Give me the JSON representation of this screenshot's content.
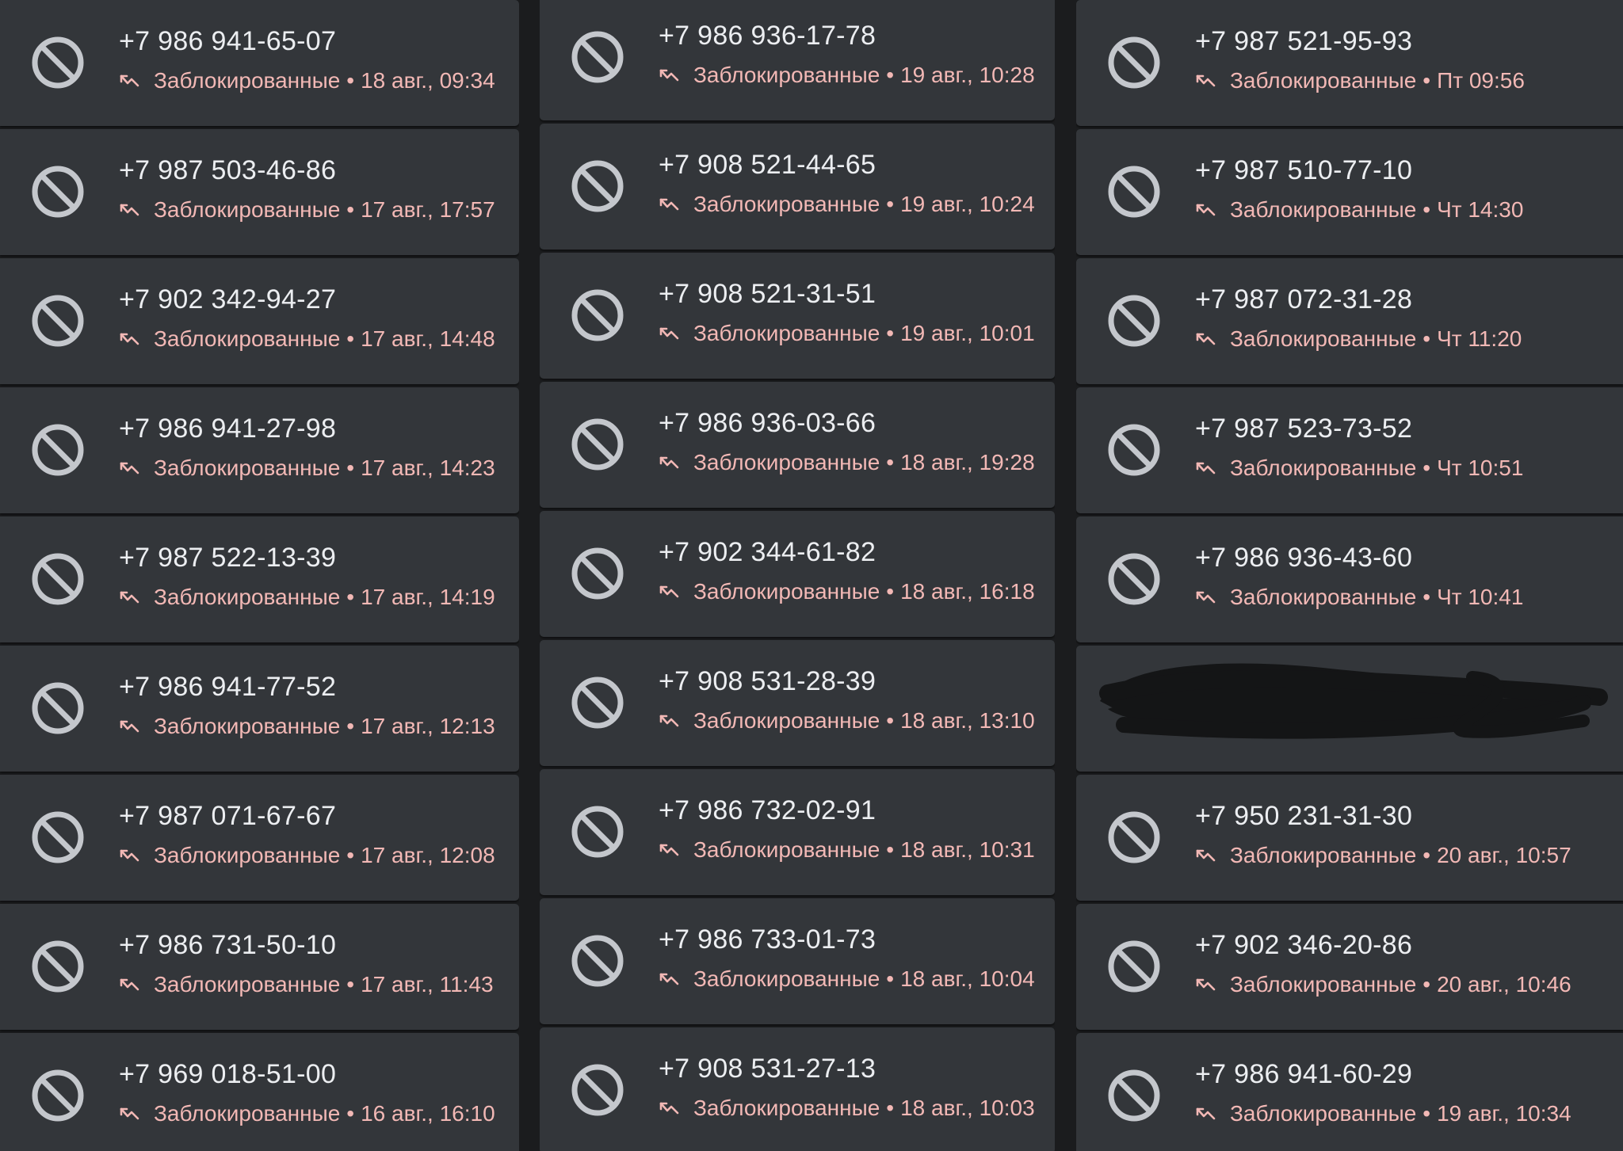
{
  "colors": {
    "card_bg": "#33363a",
    "gap_bg": "#1b1c1e",
    "number_text": "#eceef1",
    "status_text": "#f2b8b5",
    "icon": "#c4c7cc",
    "redaction": "#141516"
  },
  "icons": {
    "entry_icon": "blocked-circle-icon",
    "status_icon": "missed-call-arrow-icon"
  },
  "columns": [
    {
      "entries": [
        {
          "number": "+7 986 941-65-07",
          "label": "Заблокированные",
          "time": "18 авг., 09:34"
        },
        {
          "number": "+7 987 503-46-86",
          "label": "Заблокированные",
          "time": "17 авг., 17:57"
        },
        {
          "number": "+7 902 342-94-27",
          "label": "Заблокированные",
          "time": "17 авг., 14:48"
        },
        {
          "number": "+7 986 941-27-98",
          "label": "Заблокированные",
          "time": "17 авг., 14:23"
        },
        {
          "number": "+7 987 522-13-39",
          "label": "Заблокированные",
          "time": "17 авг., 14:19"
        },
        {
          "number": "+7 986 941-77-52",
          "label": "Заблокированные",
          "time": "17 авг., 12:13"
        },
        {
          "number": "+7 987 071-67-67",
          "label": "Заблокированные",
          "time": "17 авг., 12:08"
        },
        {
          "number": "+7 986 731-50-10",
          "label": "Заблокированные",
          "time": "17 авг., 11:43"
        },
        {
          "number": "+7 969 018-51-00",
          "label": "Заблокированные",
          "time": "16 авг., 16:10"
        }
      ]
    },
    {
      "entries": [
        {
          "number": "+7 986 936-17-78",
          "label": "Заблокированные",
          "time": "19 авг., 10:28"
        },
        {
          "number": "+7 908 521-44-65",
          "label": "Заблокированные",
          "time": "19 авг., 10:24"
        },
        {
          "number": "+7 908 521-31-51",
          "label": "Заблокированные",
          "time": "19 авг., 10:01"
        },
        {
          "number": "+7 986 936-03-66",
          "label": "Заблокированные",
          "time": "18 авг., 19:28"
        },
        {
          "number": "+7 902 344-61-82",
          "label": "Заблокированные",
          "time": "18 авг., 16:18"
        },
        {
          "number": "+7 908 531-28-39",
          "label": "Заблокированные",
          "time": "18 авг., 13:10"
        },
        {
          "number": "+7 986 732-02-91",
          "label": "Заблокированные",
          "time": "18 авг., 10:31"
        },
        {
          "number": "+7 986 733-01-73",
          "label": "Заблокированные",
          "time": "18 авг., 10:04"
        },
        {
          "number": "+7 908 531-27-13",
          "label": "Заблокированные",
          "time": "18 авг., 10:03"
        }
      ]
    },
    {
      "entries": [
        {
          "number": "+7 987 521-95-93",
          "label": "Заблокированные",
          "time": "Пт 09:56"
        },
        {
          "number": "+7 987 510-77-10",
          "label": "Заблокированные",
          "time": "Чт 14:30"
        },
        {
          "number": "+7 987 072-31-28",
          "label": "Заблокированные",
          "time": "Чт 11:20"
        },
        {
          "number": "+7 987 523-73-52",
          "label": "Заблокированные",
          "time": "Чт 10:51"
        },
        {
          "number": "+7 986 936-43-60",
          "label": "Заблокированные",
          "time": "Чт 10:41"
        },
        {
          "redacted": true
        },
        {
          "number": "+7 950 231-31-30",
          "label": "Заблокированные",
          "time": "20 авг., 10:57"
        },
        {
          "number": "+7 902 346-20-86",
          "label": "Заблокированные",
          "time": "20 авг., 10:46"
        },
        {
          "number": "+7 986 941-60-29",
          "label": "Заблокированные",
          "time": "19 авг., 10:34"
        }
      ]
    }
  ]
}
